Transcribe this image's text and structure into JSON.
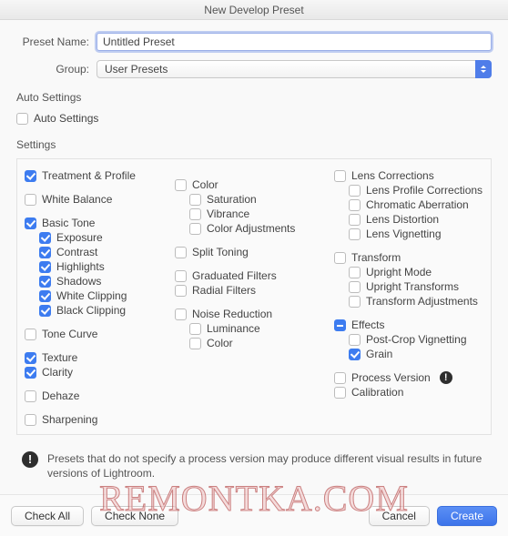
{
  "title": "New Develop Preset",
  "form": {
    "presetNameLabel": "Preset Name:",
    "presetNameValue": "Untitled Preset",
    "groupLabel": "Group:",
    "groupValue": "User Presets"
  },
  "autoSettings": {
    "heading": "Auto Settings",
    "checkboxLabel": "Auto Settings",
    "checked": false
  },
  "settings": {
    "heading": "Settings",
    "col1": {
      "treatmentProfile": "Treatment & Profile",
      "whiteBalance": "White Balance",
      "basicTone": "Basic Tone",
      "exposure": "Exposure",
      "contrast": "Contrast",
      "highlights": "Highlights",
      "shadows": "Shadows",
      "whiteClipping": "White Clipping",
      "blackClipping": "Black Clipping",
      "toneCurve": "Tone Curve",
      "texture": "Texture",
      "clarity": "Clarity",
      "dehaze": "Dehaze",
      "sharpening": "Sharpening"
    },
    "col2": {
      "color": "Color",
      "saturation": "Saturation",
      "vibrance": "Vibrance",
      "colorAdjustments": "Color Adjustments",
      "splitToning": "Split Toning",
      "graduatedFilters": "Graduated Filters",
      "radialFilters": "Radial Filters",
      "noiseReduction": "Noise Reduction",
      "luminance": "Luminance",
      "nrColor": "Color"
    },
    "col3": {
      "lensCorrections": "Lens Corrections",
      "lensProfile": "Lens Profile Corrections",
      "chromatic": "Chromatic Aberration",
      "lensDistortion": "Lens Distortion",
      "lensVignetting": "Lens Vignetting",
      "transform": "Transform",
      "uprightMode": "Upright Mode",
      "uprightTransforms": "Upright Transforms",
      "transformAdj": "Transform Adjustments",
      "effects": "Effects",
      "postCrop": "Post-Crop Vignetting",
      "grain": "Grain",
      "processVersion": "Process Version",
      "calibration": "Calibration"
    }
  },
  "warning": {
    "text": "Presets that do not specify a process version may produce different visual results in future versions of Lightroom."
  },
  "footer": {
    "checkAll": "Check All",
    "checkNone": "Check None",
    "cancel": "Cancel",
    "create": "Create"
  },
  "watermark": "REMONTKA.COM"
}
